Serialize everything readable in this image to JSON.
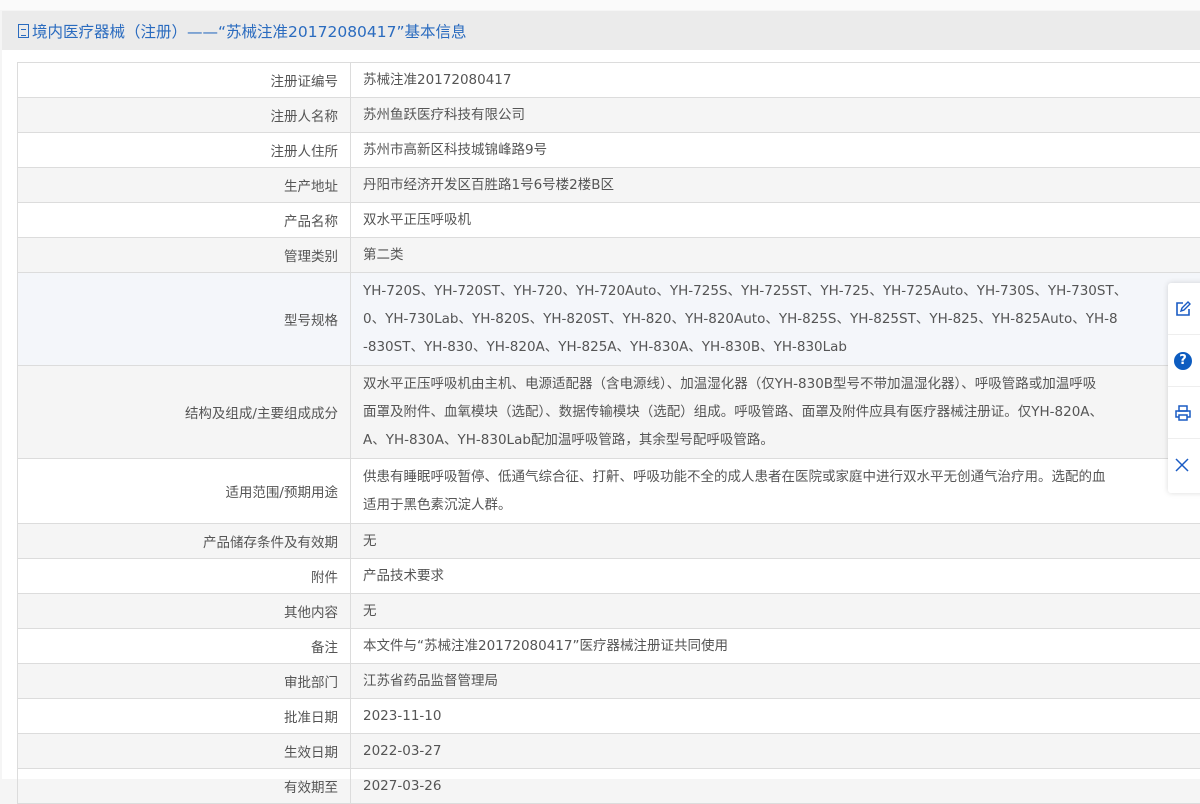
{
  "header": {
    "title": "境内医疗器械（注册）——“苏械注准20172080417”基本信息",
    "icon": "document-icon"
  },
  "rows": [
    {
      "label": "注册证编号",
      "lines": [
        "苏械注准20172080417"
      ]
    },
    {
      "label": "注册人名称",
      "lines": [
        "苏州鱼跃医疗科技有限公司"
      ]
    },
    {
      "label": "注册人住所",
      "lines": [
        "苏州市高新区科技城锦峰路9号"
      ]
    },
    {
      "label": "生产地址",
      "lines": [
        "丹阳市经济开发区百胜路1号6号楼2楼B区"
      ]
    },
    {
      "label": "产品名称",
      "lines": [
        "双水平正压呼吸机"
      ]
    },
    {
      "label": "管理类别",
      "lines": [
        "第二类"
      ]
    },
    {
      "label": "型号规格",
      "lines": [
        "YH-720S、YH-720ST、YH-720、YH-720Auto、YH-725S、YH-725ST、YH-725、YH-725Auto、YH-730S、YH-730ST、",
        "0、YH-730Lab、YH-820S、YH-820ST、YH-820、YH-820Auto、YH-825S、YH-825ST、YH-825、YH-825Auto、YH-8",
        "-830ST、YH-830、YH-820A、YH-825A、YH-830A、YH-830B、YH-830Lab"
      ]
    },
    {
      "label": "结构及组成/主要组成成分",
      "lines": [
        "双水平正压呼吸机由主机、电源适配器（含电源线）、加温湿化器（仅YH-830B型号不带加温湿化器）、呼吸管路或加温呼吸",
        "面罩及附件、血氧模块（选配）、数据传输模块（选配）组成。呼吸管路、面罩及附件应具有医疗器械注册证。仅YH-820A、",
        "A、YH-830A、YH-830Lab配加温呼吸管路，其余型号配呼吸管路。"
      ]
    },
    {
      "label": "适用范围/预期用途",
      "lines": [
        "供患有睡眠呼吸暂停、低通气综合征、打鼾、呼吸功能不全的成人患者在医院或家庭中进行双水平无创通气治疗用。选配的血",
        "适用于黑色素沉淀人群。"
      ]
    },
    {
      "label": "产品储存条件及有效期",
      "lines": [
        "无"
      ]
    },
    {
      "label": "附件",
      "lines": [
        "产品技术要求"
      ]
    },
    {
      "label": "其他内容",
      "lines": [
        "无"
      ]
    },
    {
      "label": "备注",
      "lines": [
        "本文件与“苏械注准20172080417”医疗器械注册证共同使用"
      ]
    },
    {
      "label": "审批部门",
      "lines": [
        "江苏省药品监督管理局"
      ]
    },
    {
      "label": "批准日期",
      "lines": [
        "2023-11-10"
      ]
    },
    {
      "label": "生效日期",
      "lines": [
        "2022-03-27"
      ]
    },
    {
      "label": "有效期至",
      "lines": [
        "2027-03-26"
      ]
    }
  ],
  "toolbar": {
    "items": [
      "edit-icon",
      "help-icon",
      "print-icon",
      "close-icon"
    ]
  }
}
